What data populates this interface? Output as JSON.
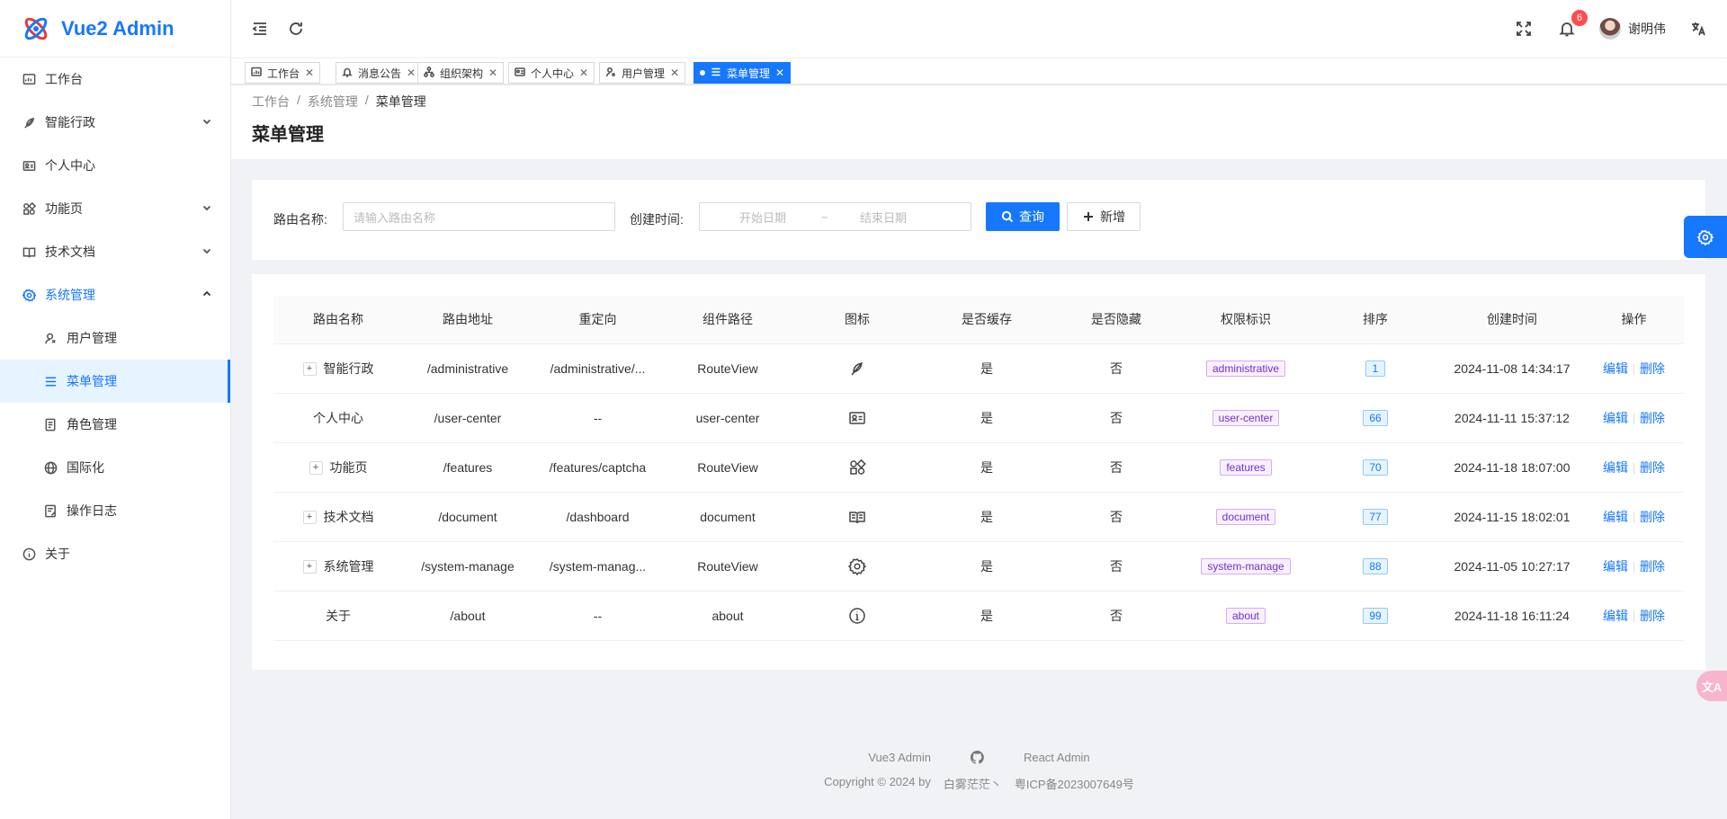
{
  "app": {
    "title": "Vue2 Admin"
  },
  "sidebar": {
    "items": [
      {
        "label": "工作台",
        "icon": "dashboard-icon"
      },
      {
        "label": "智能行政",
        "icon": "feather-icon",
        "arrow": "chevron-down"
      },
      {
        "label": "个人中心",
        "icon": "id-card-icon"
      },
      {
        "label": "功能页",
        "icon": "apps-icon",
        "arrow": "chevron-down"
      },
      {
        "label": "技术文档",
        "icon": "book-icon",
        "arrow": "chevron-down"
      },
      {
        "label": "系统管理",
        "icon": "gear-icon",
        "arrow": "chevron-up",
        "open": true
      }
    ],
    "sub_items": [
      {
        "label": "用户管理",
        "icon": "user-icon"
      },
      {
        "label": "菜单管理",
        "icon": "menu-icon",
        "active": true
      },
      {
        "label": "角色管理",
        "icon": "role-icon"
      },
      {
        "label": "国际化",
        "icon": "globe-icon"
      },
      {
        "label": "操作日志",
        "icon": "log-icon"
      }
    ],
    "after": [
      {
        "label": "关于",
        "icon": "info-icon"
      }
    ]
  },
  "header": {
    "notification_count": "6",
    "user_name": "谢明伟"
  },
  "tabs": [
    {
      "label": "工作台",
      "icon": "dashboard-icon"
    },
    {
      "label": "消息公告",
      "icon": "bell-icon"
    },
    {
      "label": "组织架构",
      "icon": "org-icon"
    },
    {
      "label": "个人中心",
      "icon": "id-card-icon"
    },
    {
      "label": "用户管理",
      "icon": "user-icon"
    },
    {
      "label": "菜单管理",
      "icon": "menu-icon",
      "active": true
    }
  ],
  "breadcrumb": [
    "工作台",
    "系统管理",
    "菜单管理"
  ],
  "breadcrumb_sep": "/",
  "page_title": "菜单管理",
  "search": {
    "route_name_label": "路由名称:",
    "route_name_placeholder": "请输入路由名称",
    "created_label": "创建时间:",
    "start_placeholder": "开始日期",
    "range_sep": "~",
    "end_placeholder": "结束日期",
    "query_label": "查询",
    "add_label": "新增"
  },
  "table": {
    "columns": [
      "路由名称",
      "路由地址",
      "重定向",
      "组件路径",
      "图标",
      "是否缓存",
      "是否隐藏",
      "权限标识",
      "排序",
      "创建时间",
      "操作"
    ],
    "rows": [
      {
        "expandable": true,
        "name": "智能行政",
        "path": "/administrative",
        "redirect": "/administrative/...",
        "component": "RouteView",
        "icon": "feather-icon",
        "cache": "是",
        "hidden": "否",
        "perm": "administrative",
        "sort": "1",
        "created": "2024-11-08 14:34:17"
      },
      {
        "expandable": false,
        "name": "个人中心",
        "path": "/user-center",
        "redirect": "--",
        "component": "user-center",
        "icon": "id-card-icon",
        "cache": "是",
        "hidden": "否",
        "perm": "user-center",
        "sort": "66",
        "created": "2024-11-11 15:37:12"
      },
      {
        "expandable": true,
        "name": "功能页",
        "path": "/features",
        "redirect": "/features/captcha",
        "component": "RouteView",
        "icon": "apps-icon",
        "cache": "是",
        "hidden": "否",
        "perm": "features",
        "sort": "70",
        "created": "2024-11-18 18:07:00"
      },
      {
        "expandable": true,
        "name": "技术文档",
        "path": "/document",
        "redirect": "/dashboard",
        "component": "document",
        "icon": "book-icon",
        "cache": "是",
        "hidden": "否",
        "perm": "document",
        "sort": "77",
        "created": "2024-11-15 18:02:01"
      },
      {
        "expandable": true,
        "name": "系统管理",
        "path": "/system-manage",
        "redirect": "/system-manag...",
        "component": "RouteView",
        "icon": "gear-icon",
        "cache": "是",
        "hidden": "否",
        "perm": "system-manage",
        "sort": "88",
        "created": "2024-11-05 10:27:17"
      },
      {
        "expandable": false,
        "name": "关于",
        "path": "/about",
        "redirect": "--",
        "component": "about",
        "icon": "info-icon",
        "cache": "是",
        "hidden": "否",
        "perm": "about",
        "sort": "99",
        "created": "2024-11-18 16:11:24"
      }
    ],
    "edit_label": "编辑",
    "delete_label": "删除"
  },
  "footer": {
    "link1": "Vue3 Admin",
    "link2": "React Admin",
    "copyright": "Copyright © 2024 by",
    "author": "白雾茫茫丶",
    "icp": "粤ICP备2023007649号"
  },
  "float_translate_label": "文A",
  "colors": {
    "primary": "#1677ff",
    "tag_purple": "#722ed1"
  }
}
